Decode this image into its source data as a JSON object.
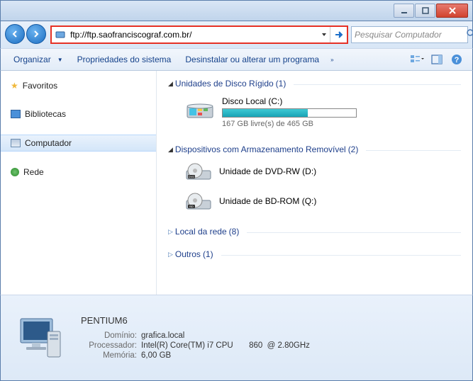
{
  "address_url": "ftp://ftp.saofranciscograf.com.br/",
  "search": {
    "placeholder": "Pesquisar Computador"
  },
  "toolbar": {
    "organize": "Organizar",
    "sysprops": "Propriedades do sistema",
    "uninstall": "Desinstalar ou alterar um programa"
  },
  "sidebar": {
    "favorites": "Favoritos",
    "libraries": "Bibliotecas",
    "computer": "Computador",
    "network": "Rede"
  },
  "sections": {
    "hdd": {
      "title": "Unidades de Disco Rígido",
      "count": "(1)"
    },
    "removable": {
      "title": "Dispositivos com Armazenamento Removível",
      "count": "(2)"
    },
    "netloc": {
      "title": "Local da rede",
      "count": "(8)"
    },
    "other": {
      "title": "Outros",
      "count": "(1)"
    }
  },
  "drives": {
    "c": {
      "name": "Disco Local (C:)",
      "free": "167 GB livre(s) de 465 GB",
      "pct": 64
    }
  },
  "devices": {
    "dvd": {
      "name": "Unidade de DVD-RW (D:)"
    },
    "bd": {
      "name": "Unidade de BD-ROM (Q:)"
    }
  },
  "details": {
    "name": "PENTIUM6",
    "domain_label": "Domínio:",
    "domain": "grafica.local",
    "cpu_label": "Processador:",
    "cpu": "Intel(R) Core(TM) i7 CPU       860  @ 2.80GHz",
    "mem_label": "Memória:",
    "mem": "6,00 GB"
  }
}
